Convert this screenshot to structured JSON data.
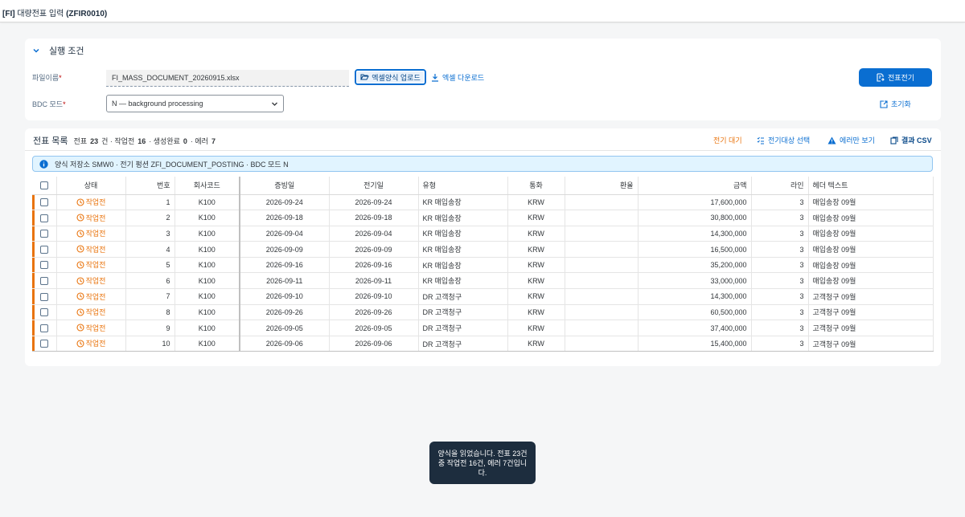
{
  "shell": {
    "title_prefix": "[FI]",
    "title_main": " 대량전표 입력 ",
    "title_code": "(ZFIR0010)"
  },
  "conditions": {
    "title": "실행 조건",
    "file_label": "파일이름",
    "file_value": "FI_MASS_DOCUMENT_20260915.xlsx",
    "upload_label": "엑셀양식 업로드",
    "download_label": "엑셀 다운로드",
    "bdc_label": "BDC 모드",
    "bdc_value": "N — background processing",
    "post_label": "전표전기",
    "reset_label": "초기화",
    "required_mark": "*"
  },
  "list": {
    "title": "전표 목록",
    "summary_prefix": "전표",
    "total": "23",
    "total_unit": "건 · 작업전",
    "pending": "16",
    "created_label": "· 생성완료",
    "created": "0",
    "error_label": "· 에러",
    "errors": "7",
    "toolbar": {
      "wait": "전기 대기",
      "select": "전기대상 선택",
      "errors_only": "에러만 보기",
      "csv": "결과 CSV"
    },
    "info": "양식 저장소 SMW0 · 전기 펑션 ZFI_DOCUMENT_POSTING · BDC 모드 N"
  },
  "columns": [
    "상태",
    "번호",
    "회사코드",
    "증빙일",
    "전기일",
    "유형",
    "통화",
    "환율",
    "금액",
    "라인",
    "헤더 텍스트"
  ],
  "rows": [
    {
      "status": "작업전",
      "no": "1",
      "company": "K100",
      "doc_date": "2026-09-24",
      "post_date": "2026-09-24",
      "type": "KR 매입송장",
      "currency": "KRW",
      "rate": "",
      "amount": "17,600,000",
      "lines": "3",
      "header": "매입송장 09월"
    },
    {
      "status": "작업전",
      "no": "2",
      "company": "K100",
      "doc_date": "2026-09-18",
      "post_date": "2026-09-18",
      "type": "KR 매입송장",
      "currency": "KRW",
      "rate": "",
      "amount": "30,800,000",
      "lines": "3",
      "header": "매입송장 09월"
    },
    {
      "status": "작업전",
      "no": "3",
      "company": "K100",
      "doc_date": "2026-09-04",
      "post_date": "2026-09-04",
      "type": "KR 매입송장",
      "currency": "KRW",
      "rate": "",
      "amount": "14,300,000",
      "lines": "3",
      "header": "매입송장 09월"
    },
    {
      "status": "작업전",
      "no": "4",
      "company": "K100",
      "doc_date": "2026-09-09",
      "post_date": "2026-09-09",
      "type": "KR 매입송장",
      "currency": "KRW",
      "rate": "",
      "amount": "16,500,000",
      "lines": "3",
      "header": "매입송장 09월"
    },
    {
      "status": "작업전",
      "no": "5",
      "company": "K100",
      "doc_date": "2026-09-16",
      "post_date": "2026-09-16",
      "type": "KR 매입송장",
      "currency": "KRW",
      "rate": "",
      "amount": "35,200,000",
      "lines": "3",
      "header": "매입송장 09월"
    },
    {
      "status": "작업전",
      "no": "6",
      "company": "K100",
      "doc_date": "2026-09-11",
      "post_date": "2026-09-11",
      "type": "KR 매입송장",
      "currency": "KRW",
      "rate": "",
      "amount": "33,000,000",
      "lines": "3",
      "header": "매입송장 09월"
    },
    {
      "status": "작업전",
      "no": "7",
      "company": "K100",
      "doc_date": "2026-09-10",
      "post_date": "2026-09-10",
      "type": "DR 고객청구",
      "currency": "KRW",
      "rate": "",
      "amount": "14,300,000",
      "lines": "3",
      "header": "고객청구 09월"
    },
    {
      "status": "작업전",
      "no": "8",
      "company": "K100",
      "doc_date": "2026-09-26",
      "post_date": "2026-09-26",
      "type": "DR 고객청구",
      "currency": "KRW",
      "rate": "",
      "amount": "60,500,000",
      "lines": "3",
      "header": "고객청구 09월"
    },
    {
      "status": "작업전",
      "no": "9",
      "company": "K100",
      "doc_date": "2026-09-05",
      "post_date": "2026-09-05",
      "type": "DR 고객청구",
      "currency": "KRW",
      "rate": "",
      "amount": "37,400,000",
      "lines": "3",
      "header": "고객청구 09월"
    },
    {
      "status": "작업전",
      "no": "10",
      "company": "K100",
      "doc_date": "2026-09-06",
      "post_date": "2026-09-06",
      "type": "DR 고객청구",
      "currency": "KRW",
      "rate": "",
      "amount": "15,400,000",
      "lines": "3",
      "header": "고객청구 09월"
    }
  ],
  "toast": "양식을 읽었습니다. 전표 23건 중 작업전 16건, 에러 7건입니다.",
  "colors": {
    "accent": "#0a6ed1",
    "warning": "#e9730c",
    "error": "#bb0000",
    "toast_bg": "#1d2d3e"
  }
}
